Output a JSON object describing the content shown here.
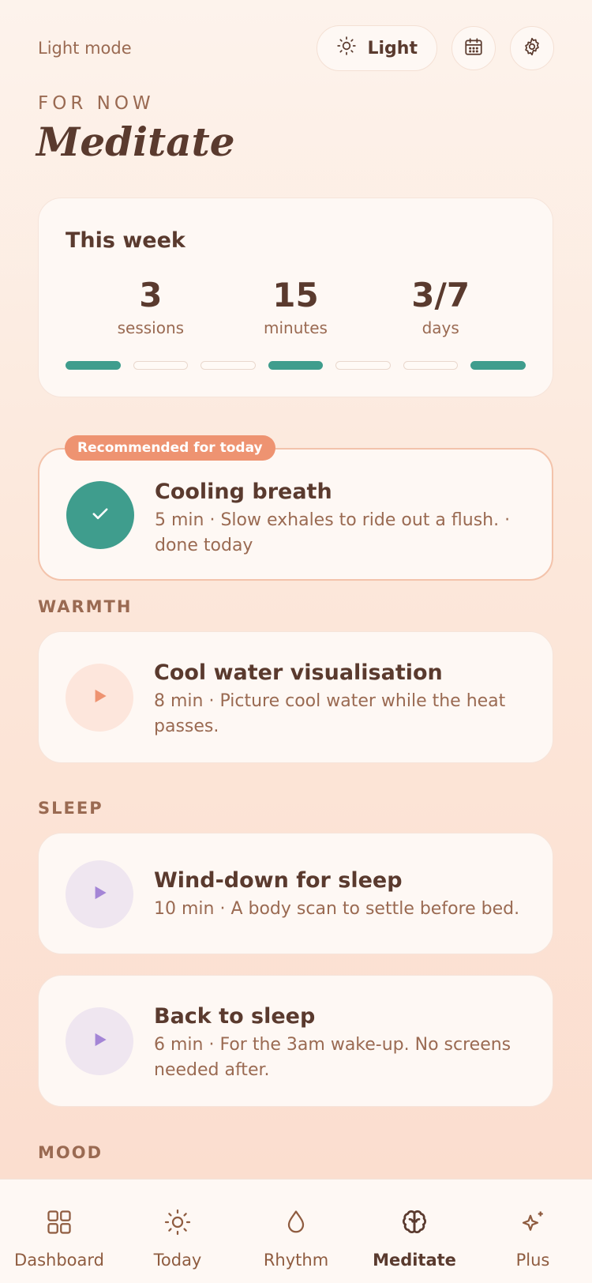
{
  "header": {
    "mode_label": "Light mode",
    "theme_button": "Light",
    "eyebrow": "FOR NOW",
    "title": "Meditate"
  },
  "week": {
    "title": "This week",
    "stats": [
      {
        "value": "3",
        "label": "sessions"
      },
      {
        "value": "15",
        "label": "minutes"
      },
      {
        "value": "3/7",
        "label": "days"
      }
    ],
    "days_done": [
      true,
      false,
      false,
      true,
      false,
      false,
      true
    ]
  },
  "recommended": {
    "badge": "Recommended for today",
    "title": "Cooling breath",
    "subtitle": "5 min · Slow exhales to ride out a flush. · done today"
  },
  "sections": {
    "warmth": "WARMTH",
    "sleep": "SLEEP",
    "mood": "MOOD"
  },
  "sessions": {
    "cool_water": {
      "title": "Cool water visualisation",
      "subtitle": "8 min · Picture cool water while the heat passes."
    },
    "wind_down": {
      "title": "Wind-down for sleep",
      "subtitle": "10 min · A body scan to settle before bed."
    },
    "back_to_sleep": {
      "title": "Back to sleep",
      "subtitle": "6 min · For the 3am wake-up. No screens needed after."
    }
  },
  "tabs": {
    "dashboard": "Dashboard",
    "today": "Today",
    "rhythm": "Rhythm",
    "meditate": "Meditate",
    "plus": "Plus"
  },
  "colors": {
    "accent_teal": "#3f9d8d",
    "accent_coral": "#ee9371",
    "accent_lavender": "#a485d6",
    "text_brown": "#5a3a2e"
  }
}
